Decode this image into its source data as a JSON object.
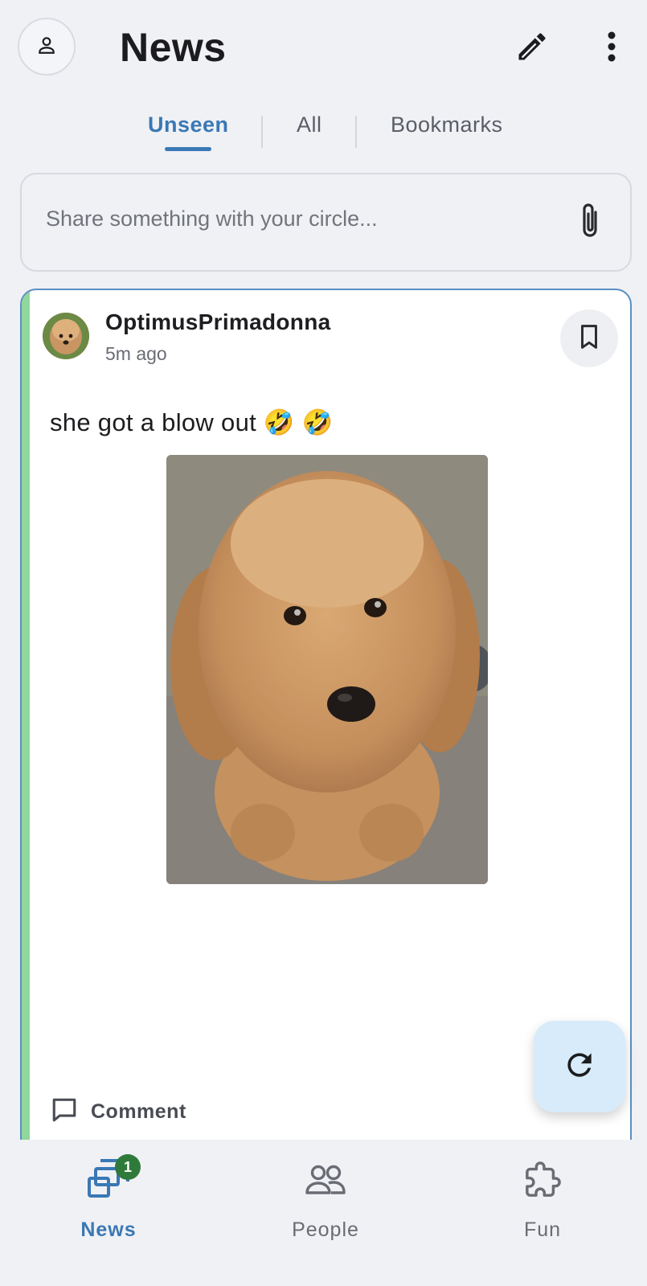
{
  "header": {
    "title": "News",
    "avatar_icon": "person-icon",
    "edit_icon": "pencil-icon",
    "more_icon": "more-vertical-icon"
  },
  "tabs": [
    {
      "label": "Unseen",
      "active": true
    },
    {
      "label": "All",
      "active": false
    },
    {
      "label": "Bookmarks",
      "active": false
    }
  ],
  "composer": {
    "placeholder": "Share something with your circle...",
    "attach_icon": "paperclip-icon"
  },
  "post": {
    "author": "OptimusPrimadonna",
    "time": "5m ago",
    "text": "she got a blow out 🤣 🤣",
    "bookmark_icon": "bookmark-icon",
    "comment_label": "Comment",
    "unseen_indicator_color": "#8fd79a"
  },
  "fab": {
    "icon": "refresh-icon"
  },
  "bottom_nav": [
    {
      "label": "News",
      "icon": "news-icon",
      "badge": "1",
      "active": true
    },
    {
      "label": "People",
      "icon": "people-icon",
      "active": false
    },
    {
      "label": "Fun",
      "icon": "puzzle-icon",
      "active": false
    }
  ],
  "colors": {
    "accent": "#3a78b5",
    "background": "#f0f1f5",
    "badge": "#2f7a3b",
    "fab": "#d7ebfa"
  }
}
